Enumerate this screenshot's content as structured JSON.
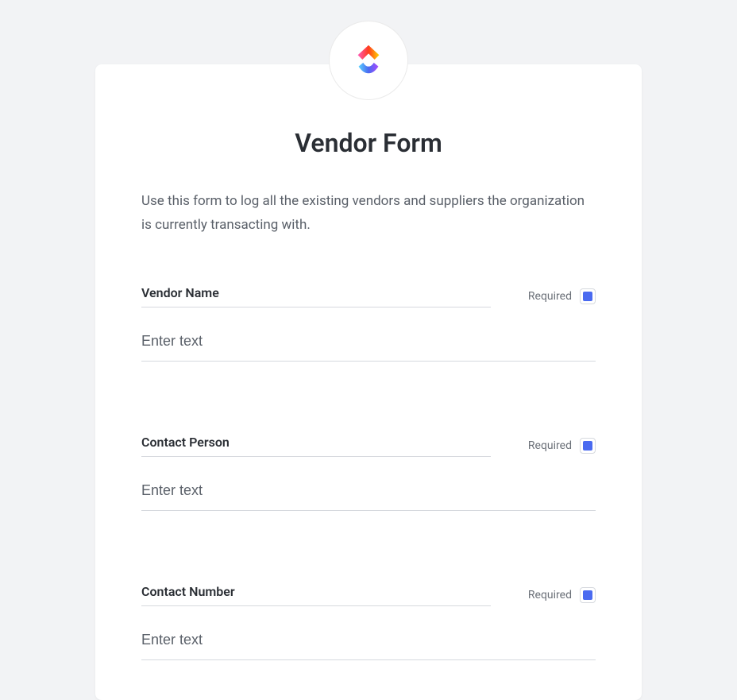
{
  "form": {
    "title": "Vendor Form",
    "description": "Use this form to log all the existing vendors and suppliers the organization is currently transacting with.",
    "fields": [
      {
        "label": "Vendor Name",
        "placeholder": "Enter text",
        "value": "",
        "required_label": "Required",
        "required": true
      },
      {
        "label": "Contact Person",
        "placeholder": "Enter text",
        "value": "",
        "required_label": "Required",
        "required": true
      },
      {
        "label": "Contact Number",
        "placeholder": "Enter text",
        "value": "",
        "required_label": "Required",
        "required": true
      }
    ]
  },
  "colors": {
    "accent": "#4a6af0"
  }
}
